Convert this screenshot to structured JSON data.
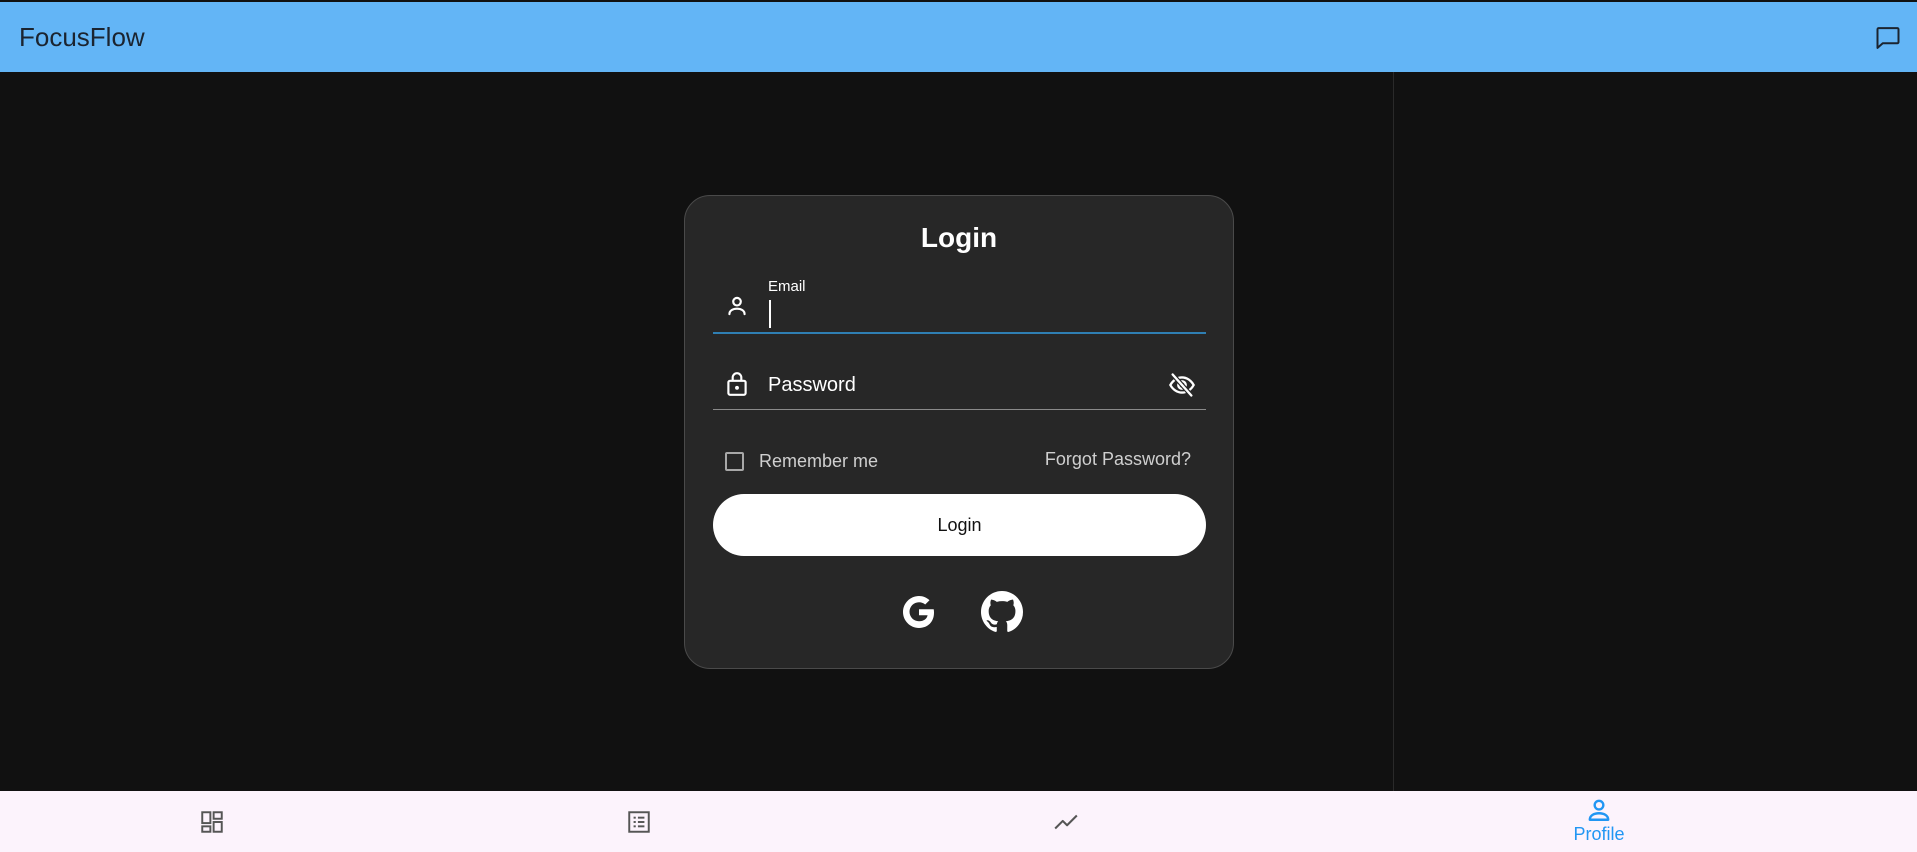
{
  "app": {
    "title": "FocusFlow"
  },
  "login": {
    "title": "Login",
    "email_label": "Email",
    "email_value": "",
    "password_placeholder": "Password",
    "remember_label": "Remember me",
    "forgot_label": "Forgot Password?",
    "login_button_label": "Login"
  },
  "icons": {
    "chat": "chat-bubble-icon",
    "email": "person-icon",
    "password": "lock-icon",
    "visibility": "visibility-off-icon",
    "google": "google-icon",
    "github": "github-icon"
  },
  "bottom_nav": {
    "items": [
      {
        "icon": "dashboard-icon",
        "label": ""
      },
      {
        "icon": "list-icon",
        "label": ""
      },
      {
        "icon": "trending-icon",
        "label": ""
      },
      {
        "icon": "person-icon",
        "label": "Profile",
        "active": true
      }
    ]
  },
  "colors": {
    "topbar": "#63b5f6",
    "background": "#111111",
    "card": "#272727",
    "accent": "#2196f3",
    "nav_background": "#fcf3fc"
  }
}
